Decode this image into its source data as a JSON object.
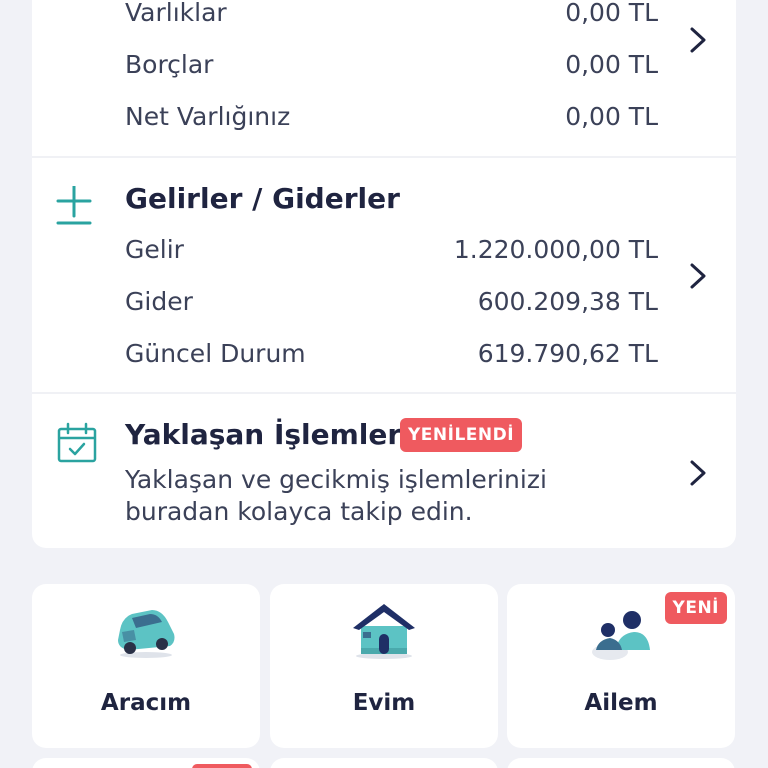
{
  "net_worth": {
    "rows": [
      {
        "label": "Varlıklar",
        "value": "0,00 TL"
      },
      {
        "label": "Borçlar",
        "value": "0,00 TL"
      },
      {
        "label": "Net Varlığınız",
        "value": "0,00 TL"
      }
    ]
  },
  "income_expense": {
    "title": "Gelirler / Giderler",
    "icon": "plus-minus-icon",
    "rows": [
      {
        "label": "Gelir",
        "value": "1.220.000,00 TL"
      },
      {
        "label": "Gider",
        "value": "600.209,38 TL"
      },
      {
        "label": "Güncel Durum",
        "value": "619.790,62 TL"
      }
    ]
  },
  "upcoming": {
    "title": "Yaklaşan İşlemler",
    "badge": "YENİLENDİ",
    "icon": "calendar-check-icon",
    "description_line1": "Yaklaşan ve gecikmiş işlemlerinizi",
    "description_line2": "buradan kolayca takip edin."
  },
  "tiles": [
    {
      "label": "Aracım",
      "icon": "car-icon"
    },
    {
      "label": "Evim",
      "icon": "house-icon"
    },
    {
      "label": "Ailem",
      "icon": "family-icon",
      "badge": "YENİ"
    }
  ],
  "colors": {
    "accent": "#2aa3a0",
    "badge": "#ef5a5f",
    "background": "#f1f2f7",
    "text": "#1f2440"
  }
}
